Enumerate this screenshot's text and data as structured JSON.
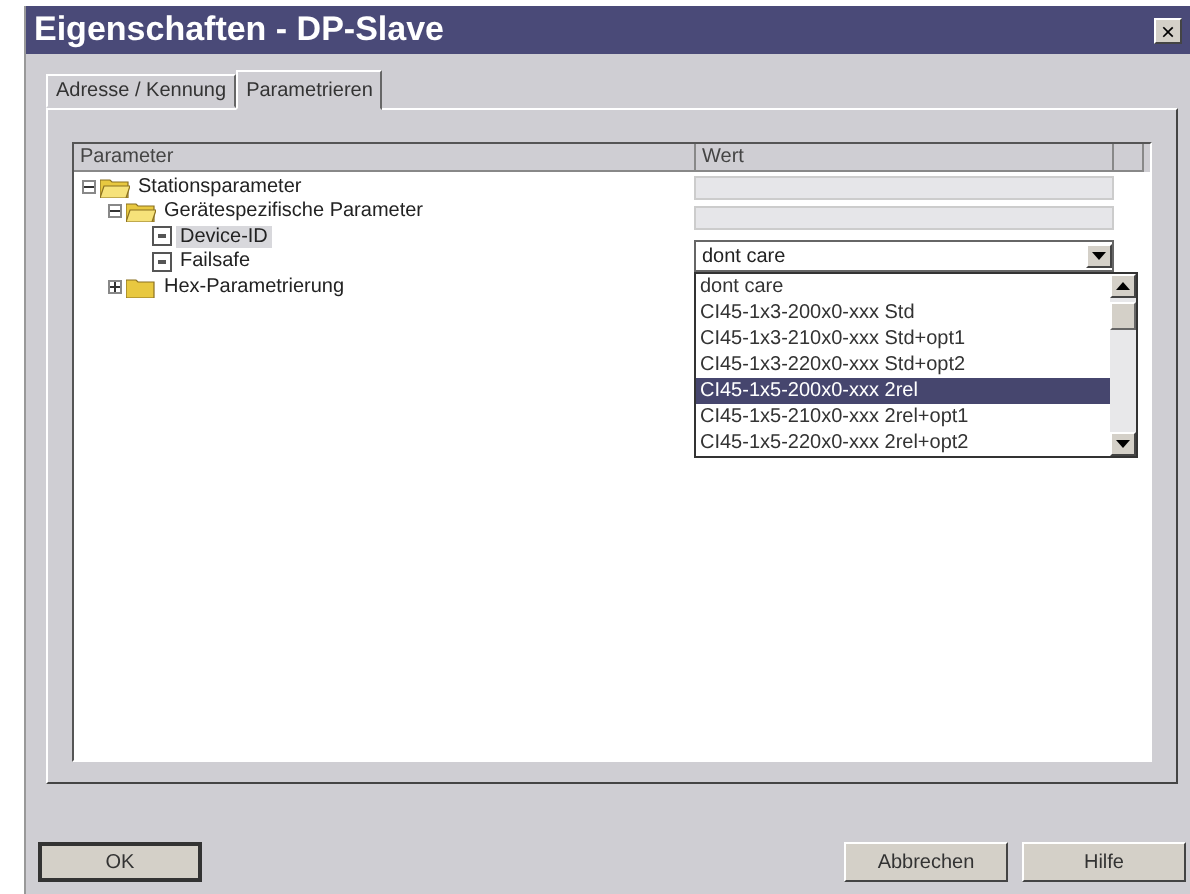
{
  "window": {
    "title": "Eigenschaften - DP-Slave",
    "close": "×"
  },
  "tabs": [
    {
      "label": "Adresse / Kennung",
      "selected": false
    },
    {
      "label": "Parametrieren",
      "selected": true
    }
  ],
  "table": {
    "columns": [
      "Parameter",
      "Wert"
    ],
    "tree": [
      {
        "label": "Stationsparameter",
        "kind": "folder",
        "expanded": true,
        "children": [
          {
            "label": "Gerätespezifische Parameter",
            "kind": "folder",
            "expanded": true,
            "children": [
              {
                "label": "Device-ID",
                "kind": "param",
                "selected": true
              },
              {
                "label": "Failsafe",
                "kind": "param",
                "selected": false
              }
            ]
          },
          {
            "label": "Hex-Parametrierung",
            "kind": "folder",
            "expanded": false
          }
        ]
      }
    ],
    "combo": {
      "value": "dont care"
    },
    "options": [
      {
        "label": "dont care",
        "selected": false
      },
      {
        "label": "CI45-1x3-200x0-xxx Std",
        "selected": false
      },
      {
        "label": "CI45-1x3-210x0-xxx Std+opt1",
        "selected": false
      },
      {
        "label": "CI45-1x3-220x0-xxx Std+opt2",
        "selected": false
      },
      {
        "label": "CI45-1x5-200x0-xxx 2rel",
        "selected": true
      },
      {
        "label": "CI45-1x5-210x0-xxx 2rel+opt1",
        "selected": false
      },
      {
        "label": "CI45-1x5-220x0-xxx 2rel+opt2",
        "selected": false
      }
    ]
  },
  "buttons": [
    {
      "label": "OK",
      "kind": "default"
    },
    {
      "label": "Abbrechen",
      "kind": "normal"
    },
    {
      "label": "Hilfe",
      "kind": "normal"
    }
  ]
}
